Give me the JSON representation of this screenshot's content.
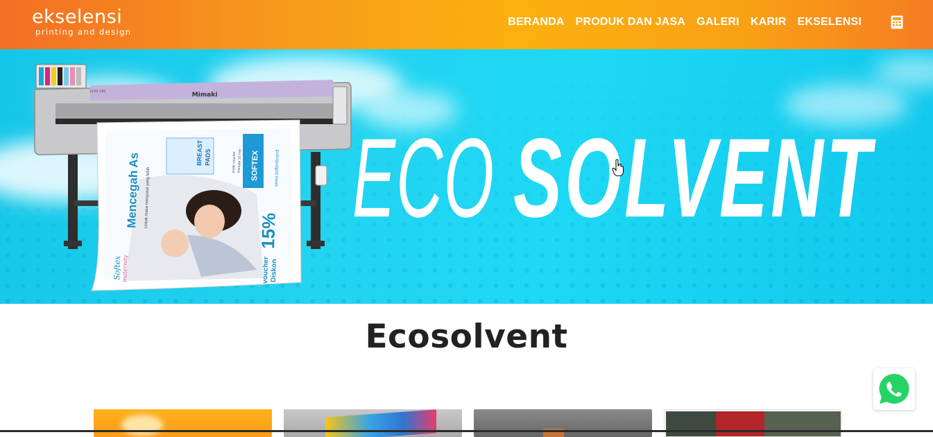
{
  "brand": {
    "name": "ekselensi",
    "tagline": "printing and design"
  },
  "nav": {
    "items": [
      {
        "label": "BERANDA"
      },
      {
        "label": "PRODUK DAN JASA"
      },
      {
        "label": "GALERI"
      },
      {
        "label": "KARIR"
      },
      {
        "label": "EKSELENSI"
      }
    ],
    "calculator_icon": "calculator-icon"
  },
  "hero": {
    "word_light": "ECO",
    "word_bold": "SOLVENT",
    "printer_brand": "Mimaki",
    "printer_model": "JV33-160",
    "banner": {
      "headline": "Mencegah As",
      "subline": "Untuk masa menyusui yang lebih",
      "percent": "15%",
      "voucher_line1": "voucher",
      "voucher_line2": "Diskon",
      "brand_line1": "Softex",
      "brand_line2": "maternity",
      "pads_line1": "BREAST",
      "pads_line2": "PADS",
      "badge": "SOFTEX",
      "url": "www.softexbrand",
      "side_note": "Kode voucher",
      "period": "Periode 15 Feb -"
    }
  },
  "page": {
    "title": "Ecosolvent"
  },
  "whatsapp": {
    "icon": "whatsapp-icon"
  },
  "colors": {
    "header_orange": "#f57c22",
    "header_amber": "#fcb010",
    "hero_cyan": "#1ed8f4",
    "title_text": "#222222",
    "whatsapp_green": "#25d366"
  }
}
